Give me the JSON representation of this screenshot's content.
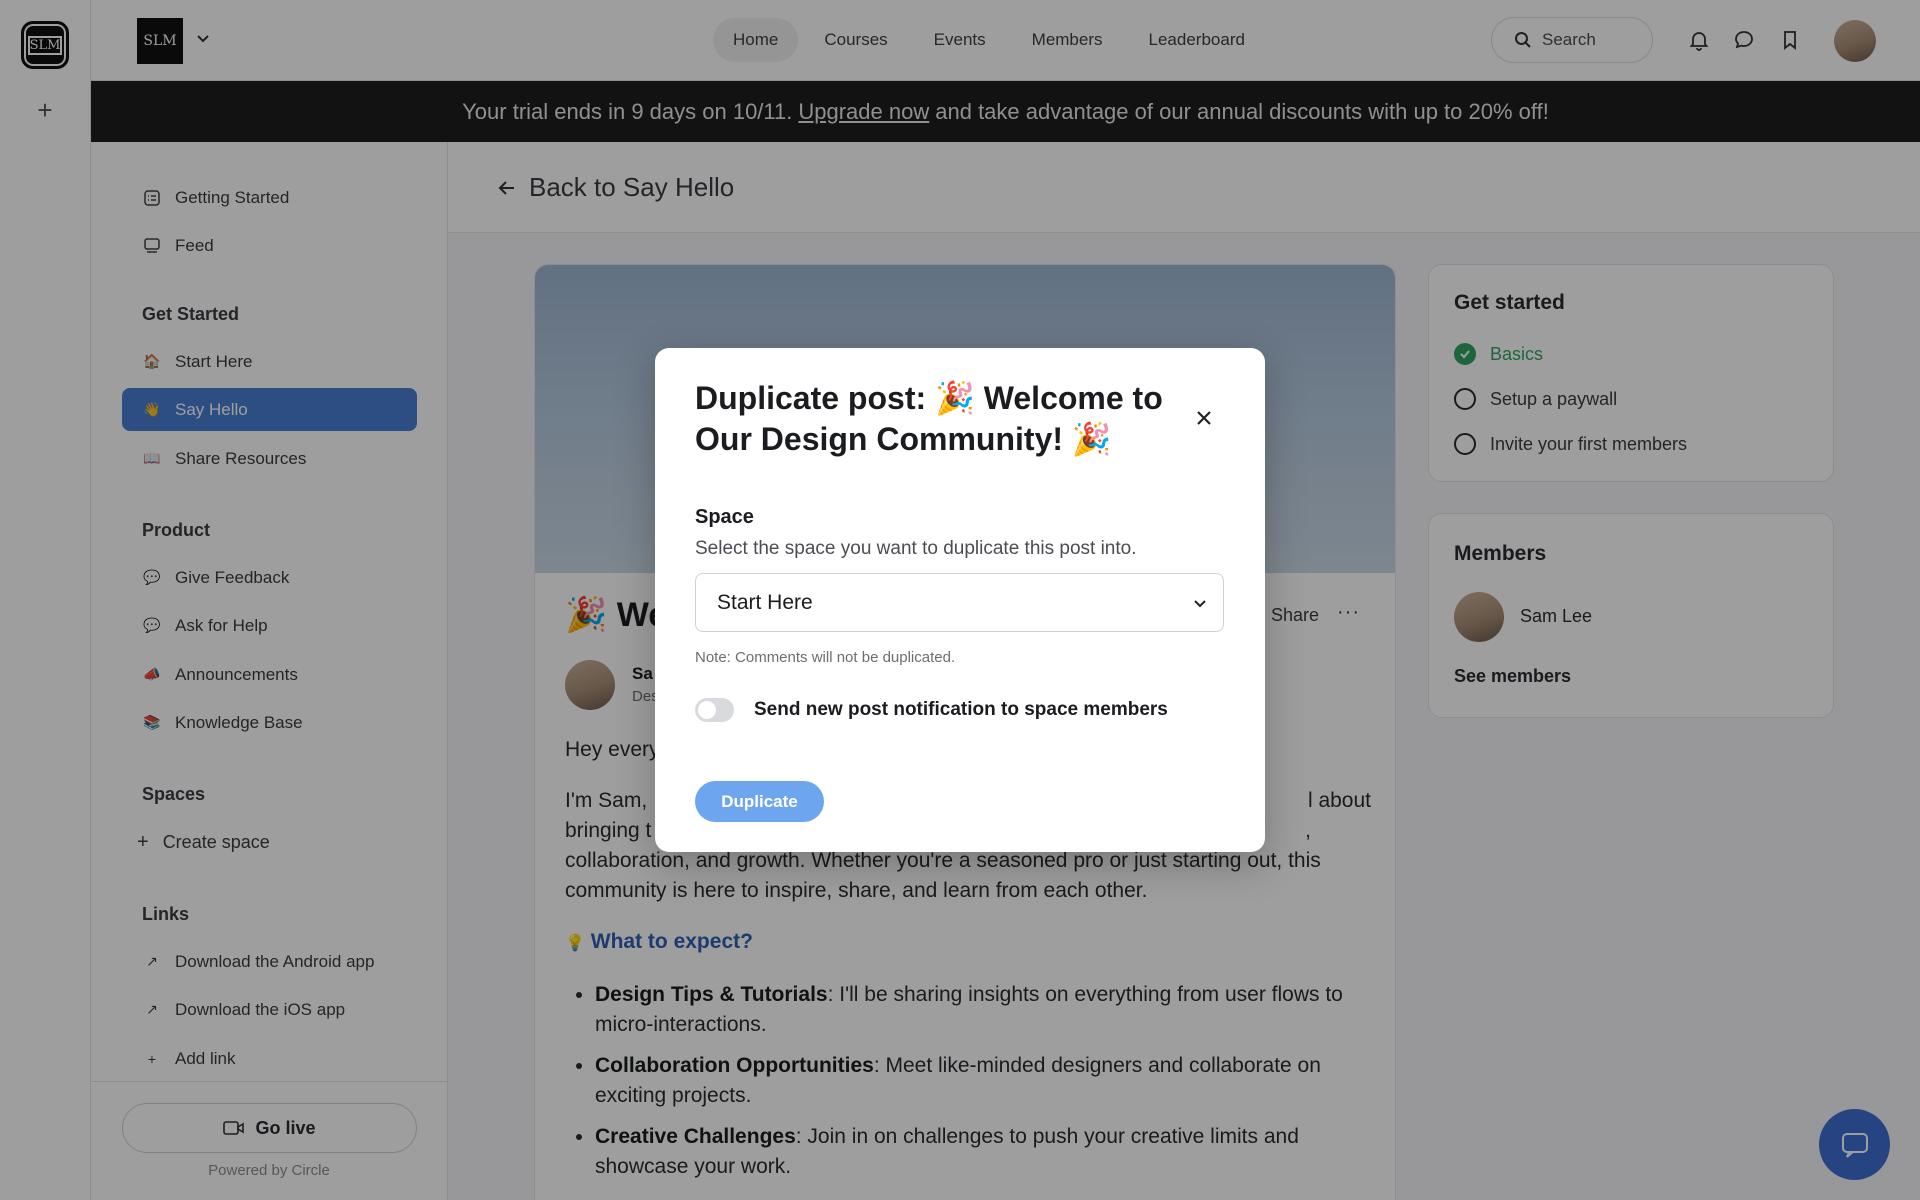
{
  "rail": {
    "logo_text": "SLM",
    "add_icon": "plus-icon"
  },
  "header": {
    "brand_text": "SLM",
    "nav": [
      {
        "label": "Home",
        "active": true
      },
      {
        "label": "Courses"
      },
      {
        "label": "Events"
      },
      {
        "label": "Members"
      },
      {
        "label": "Leaderboard"
      }
    ],
    "search_label": "Search",
    "icons": [
      "bell-icon",
      "chat-icon",
      "bookmark-icon"
    ]
  },
  "banner": {
    "prefix": "Your trial ends in 9 days on 10/11.",
    "link": "Upgrade now",
    "suffix": "and take advantage of our annual discounts with up to 20% off!"
  },
  "sidebar": {
    "top_items": [
      {
        "label": "Getting Started",
        "icon": "checklist-icon"
      },
      {
        "label": "Feed",
        "icon": "feed-icon"
      }
    ],
    "sections": [
      {
        "heading": "Get Started",
        "items": [
          {
            "label": "Start Here",
            "emoji": "🏠"
          },
          {
            "label": "Say Hello",
            "emoji": "👋",
            "active": true
          },
          {
            "label": "Share Resources",
            "emoji": "📖"
          }
        ]
      },
      {
        "heading": "Product",
        "items": [
          {
            "label": "Give Feedback",
            "emoji": "💬"
          },
          {
            "label": "Ask for Help",
            "emoji": "💬"
          },
          {
            "label": "Announcements",
            "emoji": "📣"
          },
          {
            "label": "Knowledge Base",
            "emoji": "📚"
          }
        ]
      }
    ],
    "spaces_heading": "Spaces",
    "create_space": "Create space",
    "links_heading": "Links",
    "links": [
      {
        "label": "Download the Android app"
      },
      {
        "label": "Download the iOS app"
      },
      {
        "label": "Add link"
      }
    ],
    "go_live": "Go live",
    "powered_by": "Powered by Circle"
  },
  "main": {
    "back_label": "Back to Say Hello",
    "post": {
      "title_visible": "🎉 Wel",
      "share": "Share",
      "more": "···",
      "author_name": "Sa",
      "author_role": "Des",
      "greeting": "Hey every",
      "intro_line1_start": "I'm Sam, ",
      "intro_line1_end": "l about",
      "intro_line2_start": "bringing t",
      "intro_line2_end": ",",
      "intro_line3": "collaboration, and growth. Whether you're a seasoned pro or just starting out, this",
      "intro_line4": "community is here to inspire, share, and learn from each other.",
      "subheading_emoji": "💡",
      "subheading": "What to expect?",
      "bullets": [
        {
          "bold": "Design Tips & Tutorials",
          "text": ": I'll be sharing insights on everything from user flows to micro-interactions."
        },
        {
          "bold": "Collaboration Opportunities",
          "text": ": Meet like-minded designers and collaborate on exciting projects."
        },
        {
          "bold": "Creative Challenges",
          "text": ": Join in on challenges to push your creative limits and showcase your work."
        }
      ]
    }
  },
  "get_started": {
    "title": "Get started",
    "steps": [
      {
        "label": "Basics",
        "done": true
      },
      {
        "label": "Setup a paywall",
        "done": false
      },
      {
        "label": "Invite your first members",
        "done": false
      }
    ]
  },
  "members_widget": {
    "title": "Members",
    "member_name": "Sam Lee",
    "see_members": "See members"
  },
  "modal": {
    "title": "Duplicate post: 🎉 Welcome to Our Design Community! 🎉",
    "space_label": "Space",
    "space_help": "Select the space you want to duplicate this post into.",
    "selected_space": "Start Here",
    "note": "Note: Comments will not be duplicated.",
    "toggle_label": "Send new post notification to space members",
    "toggle_on": false,
    "duplicate_button": "Duplicate"
  },
  "colors": {
    "accent": "#4a7fd4",
    "banner_bg": "#1d1e20",
    "success": "#2fa561",
    "duplicate_button": "#6ea5ef",
    "link": "#2f5fb3"
  }
}
